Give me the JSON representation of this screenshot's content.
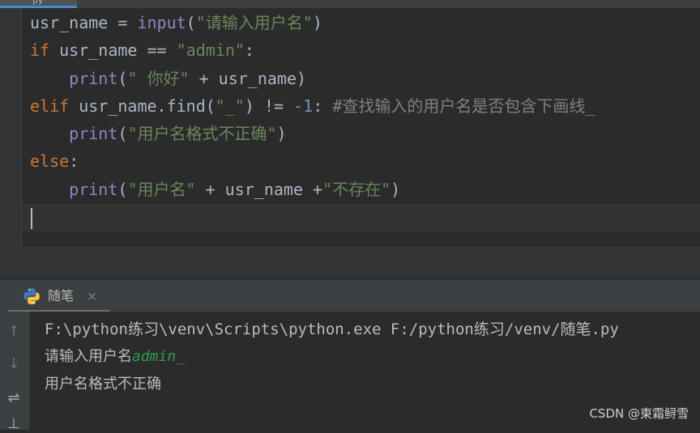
{
  "editor": {
    "tab_label": "py",
    "code_lines": [
      [
        {
          "t": "usr_name = ",
          "c": ""
        },
        {
          "t": "input",
          "c": "bi"
        },
        {
          "t": "(",
          "c": ""
        },
        {
          "t": "\"请输入用户名\"",
          "c": "str"
        },
        {
          "t": ")",
          "c": ""
        }
      ],
      [
        {
          "t": "if ",
          "c": "kw"
        },
        {
          "t": "usr_name == ",
          "c": ""
        },
        {
          "t": "\"admin\"",
          "c": "str"
        },
        {
          "t": ":",
          "c": ""
        }
      ],
      [
        {
          "t": "    ",
          "c": ""
        },
        {
          "t": "print",
          "c": "bi"
        },
        {
          "t": "(",
          "c": ""
        },
        {
          "t": "\" 你好\"",
          "c": "str"
        },
        {
          "t": " + usr_name)",
          "c": ""
        }
      ],
      [
        {
          "t": "elif ",
          "c": "kw"
        },
        {
          "t": "usr_name.find(",
          "c": ""
        },
        {
          "t": "\"_\"",
          "c": "str"
        },
        {
          "t": ") != ",
          "c": ""
        },
        {
          "t": "-1",
          "c": "num"
        },
        {
          "t": ": ",
          "c": ""
        },
        {
          "t": "#查找输入的用户名是否包含下画线_",
          "c": "cmt"
        }
      ],
      [
        {
          "t": "    ",
          "c": ""
        },
        {
          "t": "print",
          "c": "bi"
        },
        {
          "t": "(",
          "c": ""
        },
        {
          "t": "\"用户名格式不正确\"",
          "c": "str"
        },
        {
          "t": ")",
          "c": ""
        }
      ],
      [
        {
          "t": "else",
          "c": "kw"
        },
        {
          "t": ":",
          "c": ""
        }
      ],
      [
        {
          "t": "    ",
          "c": ""
        },
        {
          "t": "print",
          "c": "bi"
        },
        {
          "t": "(",
          "c": ""
        },
        {
          "t": "\"用户名\"",
          "c": "str"
        },
        {
          "t": " + usr_name +",
          "c": ""
        },
        {
          "t": "\"不存在\"",
          "c": "str"
        },
        {
          "t": ")",
          "c": ""
        }
      ]
    ]
  },
  "run_panel": {
    "tab_label": "随笔",
    "tab_icon": "python-icon",
    "close_glyph": "×",
    "toolbar": [
      {
        "name": "rerun-up-icon",
        "glyph": "↑"
      },
      {
        "name": "scroll-down-icon",
        "glyph": "↓"
      },
      {
        "name": "soft-wrap-icon",
        "glyph": "⇌"
      },
      {
        "name": "pin-tab-icon",
        "glyph": "⊥"
      }
    ],
    "console": {
      "command": "F:\\python练习\\venv\\Scripts\\python.exe F:/python练习/venv/随笔.py",
      "prompt": "请输入用户名",
      "user_input": "admin_",
      "output": "用户名格式不正确"
    }
  },
  "watermark": "CSDN @東霜鲟雪",
  "colors": {
    "background": "#2b2b2b",
    "keyword": "#cc7832",
    "builtin": "#8888c6",
    "string": "#6a8759",
    "number": "#6897bb",
    "comment": "#808080",
    "console_input": "#2f9e44"
  }
}
